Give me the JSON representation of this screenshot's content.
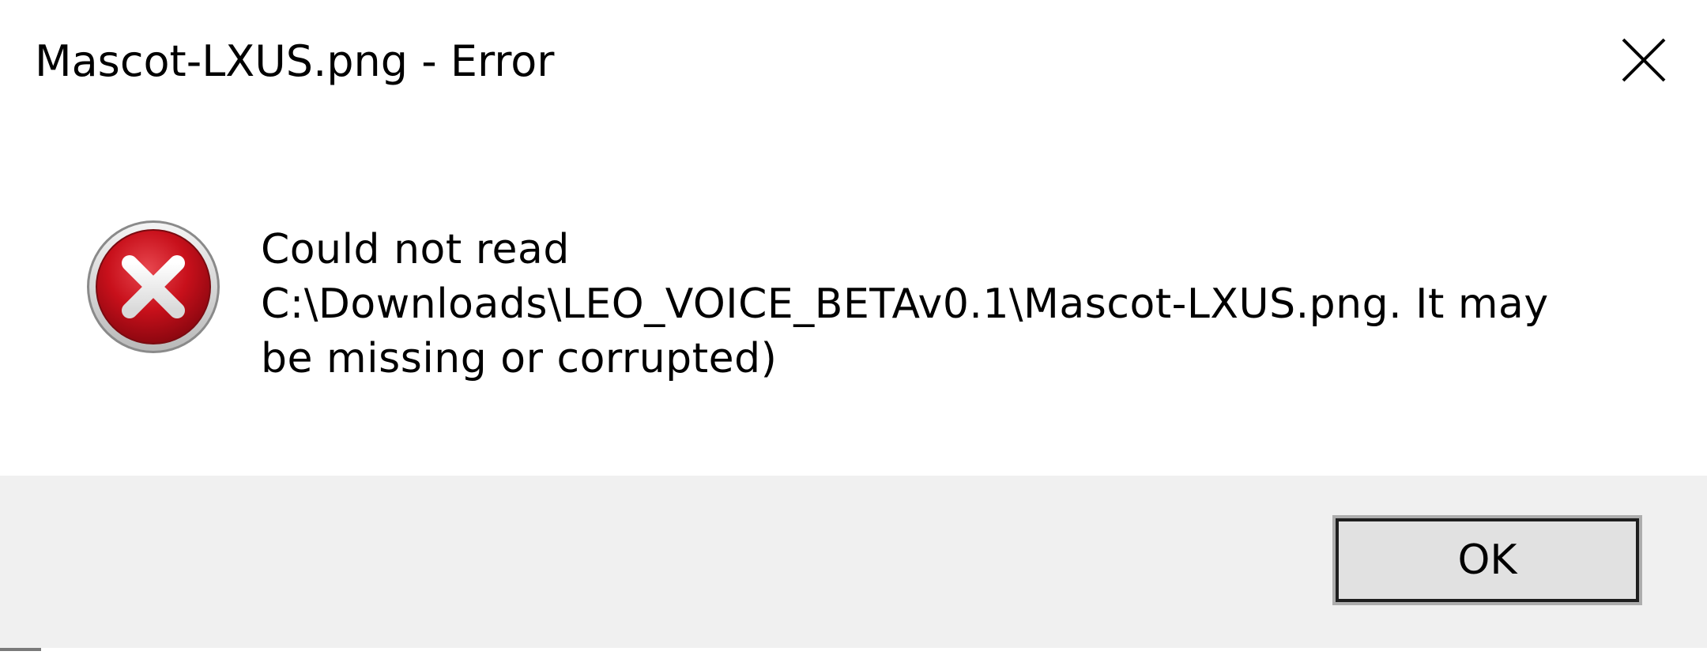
{
  "window": {
    "title": "Mascot-LXUS.png - Error",
    "close_icon": "close-icon"
  },
  "message": {
    "icon": "error-icon",
    "lines": [
      "Could not read",
      "C:\\Downloads\\LEO_VOICE_BETAv0.1\\Mascot-LXUS.png. It may",
      "be missing or corrupted)"
    ]
  },
  "buttons": {
    "ok_label": "OK"
  },
  "colors": {
    "footer_bg": "#f0f0f0",
    "error_red": "#c8101b",
    "button_bg": "#e1e1e1"
  }
}
